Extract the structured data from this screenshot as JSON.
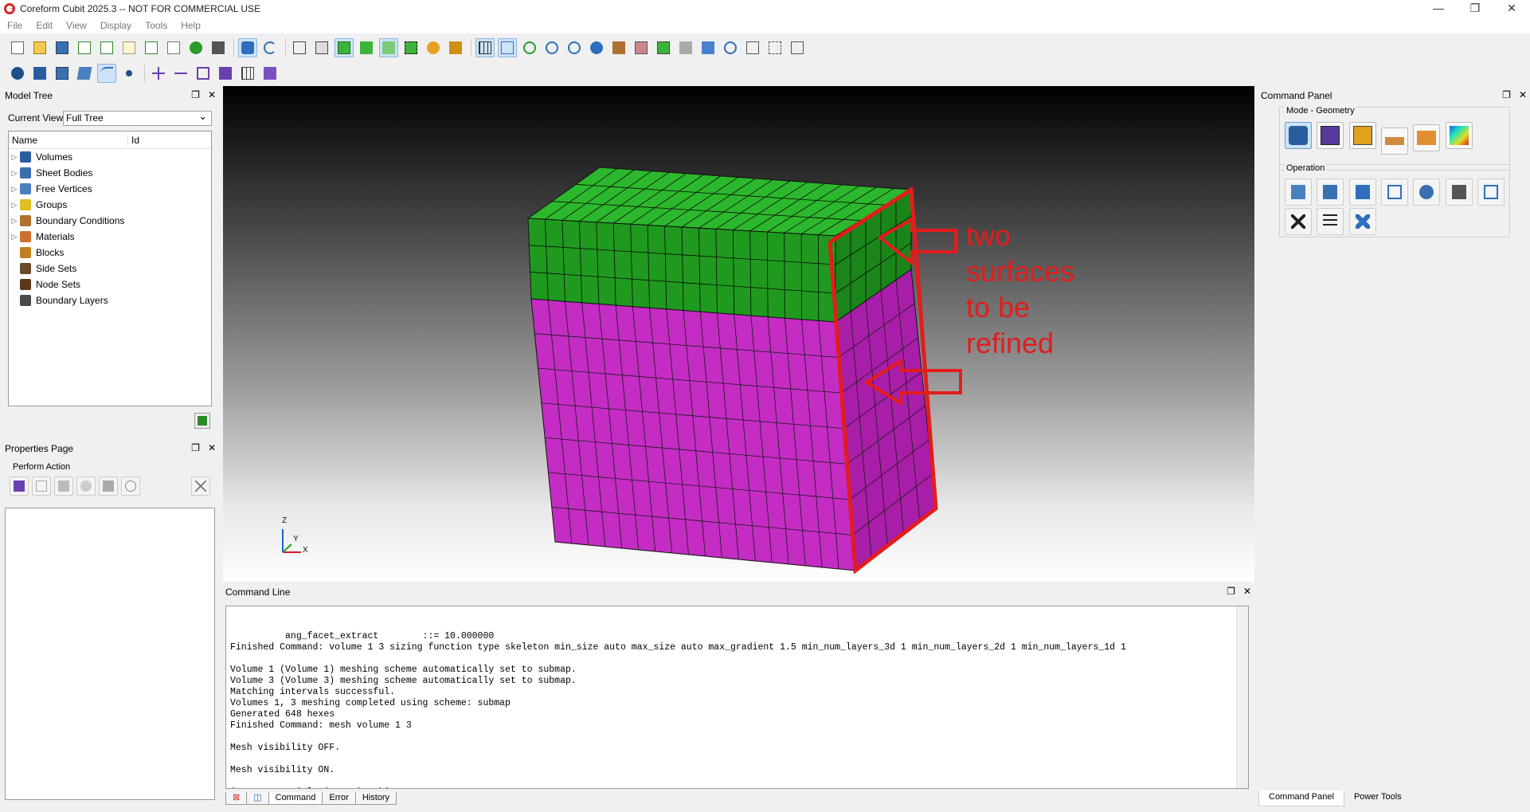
{
  "window": {
    "title": "Coreform Cubit 2025.3 -- NOT FOR COMMERCIAL USE",
    "min": "—",
    "restore": "❐",
    "close": "✕"
  },
  "menu": [
    "File",
    "Edit",
    "View",
    "Display",
    "Tools",
    "Help"
  ],
  "model_tree": {
    "title": "Model Tree",
    "current_view_label": "Current View",
    "current_view_value": "Full Tree",
    "col_name": "Name",
    "col_id": "Id",
    "items": [
      {
        "label": "Volumes",
        "expandable": true,
        "icon": "volumes-icon"
      },
      {
        "label": "Sheet Bodies",
        "expandable": true,
        "icon": "sheet-bodies-icon"
      },
      {
        "label": "Free Vertices",
        "expandable": true,
        "icon": "free-vertices-icon"
      },
      {
        "label": "Groups",
        "expandable": true,
        "icon": "groups-icon"
      },
      {
        "label": "Boundary Conditions",
        "expandable": true,
        "icon": "boundary-conditions-icon"
      },
      {
        "label": "Materials",
        "expandable": true,
        "icon": "materials-icon"
      },
      {
        "label": "Blocks",
        "expandable": false,
        "icon": "blocks-icon"
      },
      {
        "label": "Side Sets",
        "expandable": false,
        "icon": "side-sets-icon"
      },
      {
        "label": "Node Sets",
        "expandable": false,
        "icon": "node-sets-icon"
      },
      {
        "label": "Boundary Layers",
        "expandable": false,
        "icon": "boundary-layers-icon"
      }
    ]
  },
  "properties": {
    "title": "Properties Page",
    "perform_action": "Perform Action"
  },
  "command_panel": {
    "title": "Command Panel",
    "mode_label": "Mode - Geometry",
    "operation_label": "Operation",
    "tabs": [
      "Command Panel",
      "Power Tools"
    ]
  },
  "command_line": {
    "title": "Command Line",
    "lines": [
      "          ang_facet_extract        ::= 10.000000",
      "Finished Command: volume 1 3 sizing function type skeleton min_size auto max_size auto max_gradient 1.5 min_num_layers_3d 1 min_num_layers_2d 1 min_num_layers_1d 1",
      "",
      "Volume 1 (Volume 1) meshing scheme automatically set to submap.",
      "Volume 3 (Volume 3) meshing scheme automatically set to submap.",
      "Matching intervals successful.",
      "Volumes 1, 3 meshing completed using scheme: submap",
      "Generated 648 hexes",
      "Finished Command: mesh volume 1 3",
      "",
      "Mesh visibility OFF.",
      "",
      "Mesh visibility ON.",
      "",
      "(Non-Commercial License) Cubit>"
    ],
    "tabs": [
      "Command",
      "Error",
      "History"
    ]
  },
  "annotation": {
    "lines": [
      "two",
      "surfaces",
      "to be",
      "refined"
    ],
    "color": "#e31c1c"
  },
  "axis": {
    "z": "Z",
    "y": "Y",
    "x": "X"
  },
  "colors": {
    "top_volume": "#22b422",
    "bottom_volume": "#c832c8",
    "highlight": "#e31c1c"
  }
}
